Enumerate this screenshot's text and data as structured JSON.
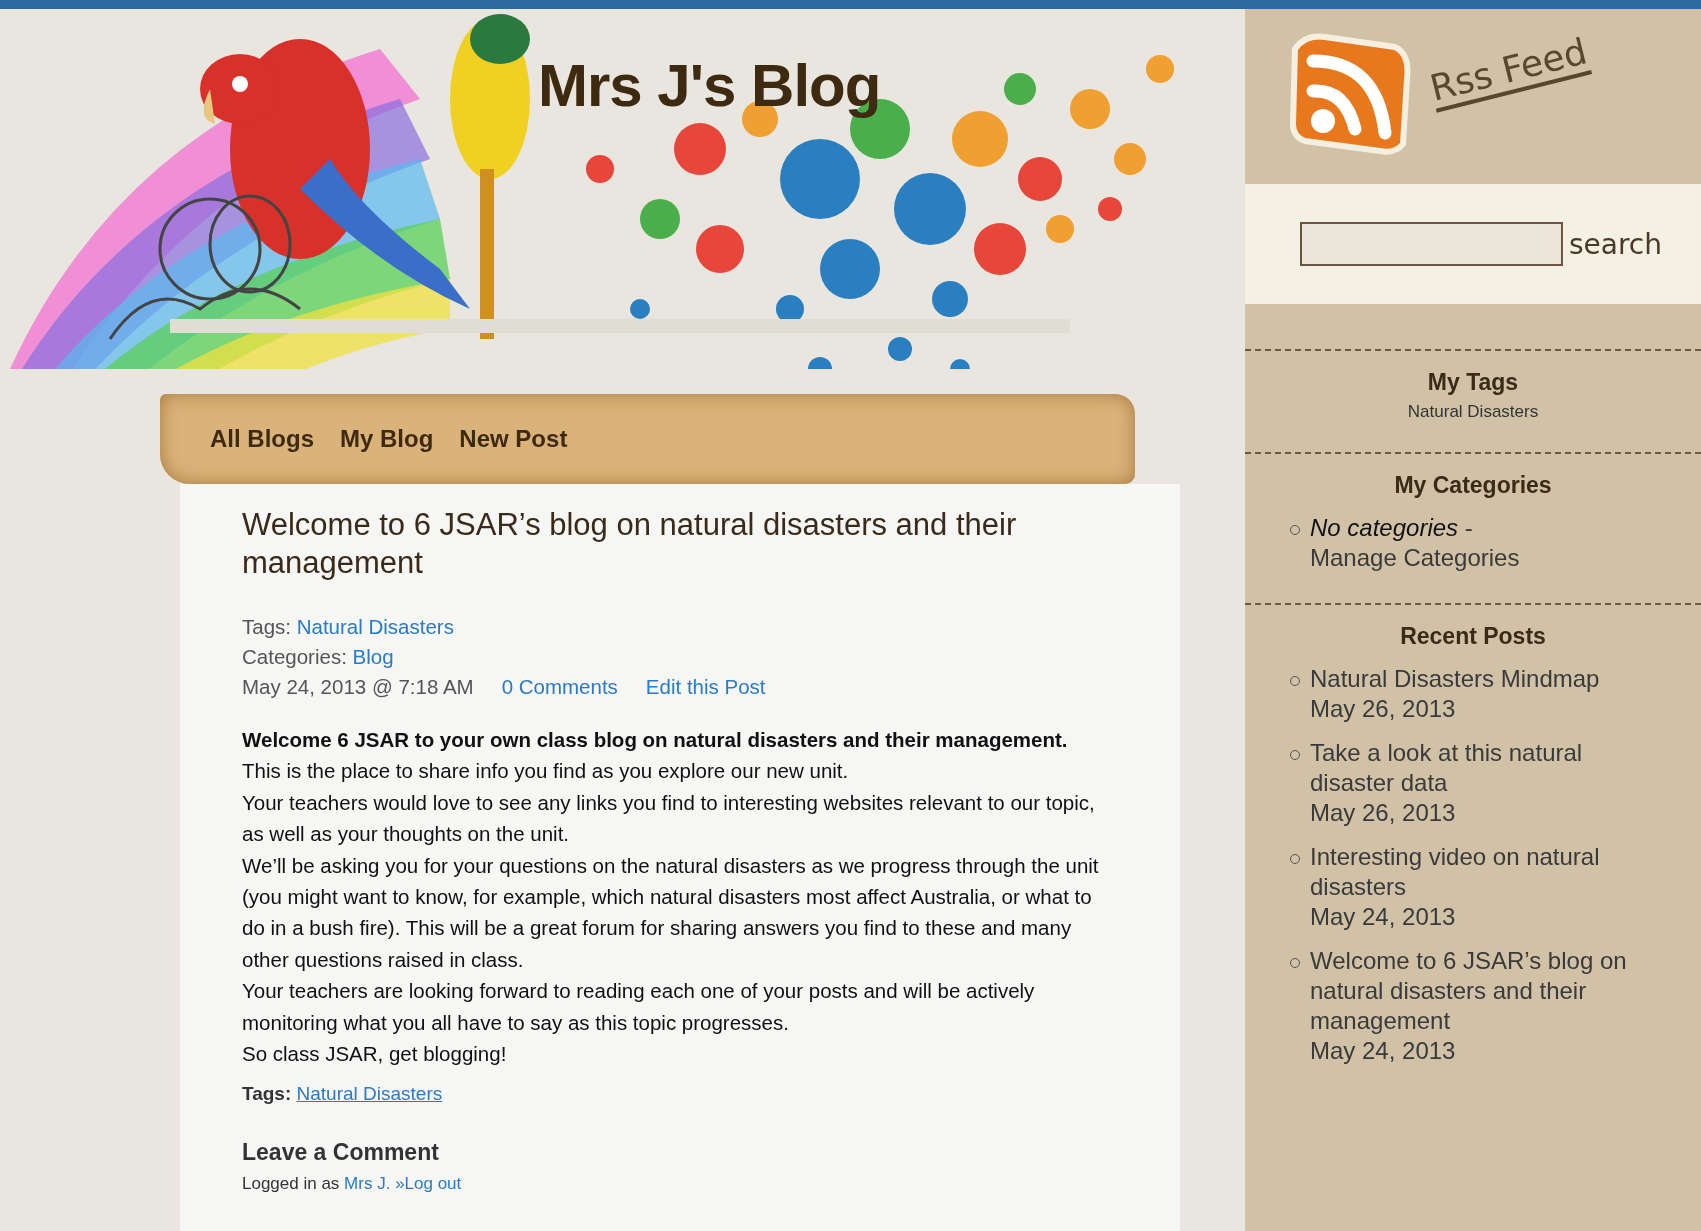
{
  "blog_title": "Mrs J's Blog",
  "nav": [
    {
      "label": "All Blogs"
    },
    {
      "label": "My Blog"
    },
    {
      "label": "New Post"
    }
  ],
  "post": {
    "title": "Welcome to 6 JSAR’s blog on natural disasters and their management",
    "tags_label": "Tags:",
    "tags_link": "Natural Disasters",
    "categories_label": "Categories:",
    "categories_link": "Blog",
    "date": "May 24, 2013 @ 7:18 AM",
    "comments_link": "0 Comments",
    "edit_link": "Edit this Post",
    "paragraphs": [
      {
        "kind": "bold",
        "text": "Welcome 6 JSAR to your own class blog on natural disasters and their management."
      },
      {
        "kind": "plain",
        "text": "This is the place to share info you find as you explore our new unit."
      },
      {
        "kind": "plain",
        "text": "Your teachers would love to see any links you find to interesting websites relevant to our topic, as well as your thoughts on the unit."
      },
      {
        "kind": "plain",
        "text": "We’ll be asking you for your questions on the natural disasters as we progress through the unit (you might want to know, for example, which natural disasters most affect Australia, or what to do in a bush fire). This will be a great forum for sharing answers you find to these and many other questions raised in class."
      },
      {
        "kind": "plain",
        "text": "Your teachers are looking forward to reading each one of your posts and will be actively monitoring what you all have to say as this topic progresses."
      },
      {
        "kind": "plain",
        "text": "So class JSAR, get blogging!"
      }
    ],
    "footer_tags_label": "Tags:",
    "footer_tags_link": "Natural Disasters"
  },
  "comment": {
    "heading": "Leave a Comment",
    "logged_in_prefix": "Logged in as",
    "user_link": "Mrs J.",
    "logout_link": "»Log out"
  },
  "sidebar": {
    "rss_label": "Rss Feed",
    "search_label": "search",
    "tags": {
      "heading": "My Tags",
      "items": [
        "Natural Disasters"
      ]
    },
    "categories": {
      "heading": "My Categories",
      "empty_text": "No categories",
      "separator": "-",
      "manage_link": "Manage Categories"
    },
    "recent": {
      "heading": "Recent Posts",
      "items": [
        {
          "title": "Natural Disasters Mindmap",
          "date": "May 26, 2013"
        },
        {
          "title": "Take a look at this natural disaster data",
          "date": "May 26, 2013"
        },
        {
          "title": "Interesting video on natural disasters",
          "date": "May 24, 2013"
        },
        {
          "title": "Welcome to 6 JSAR’s blog on natural disasters and their management",
          "date": "May 24, 2013"
        }
      ]
    }
  }
}
